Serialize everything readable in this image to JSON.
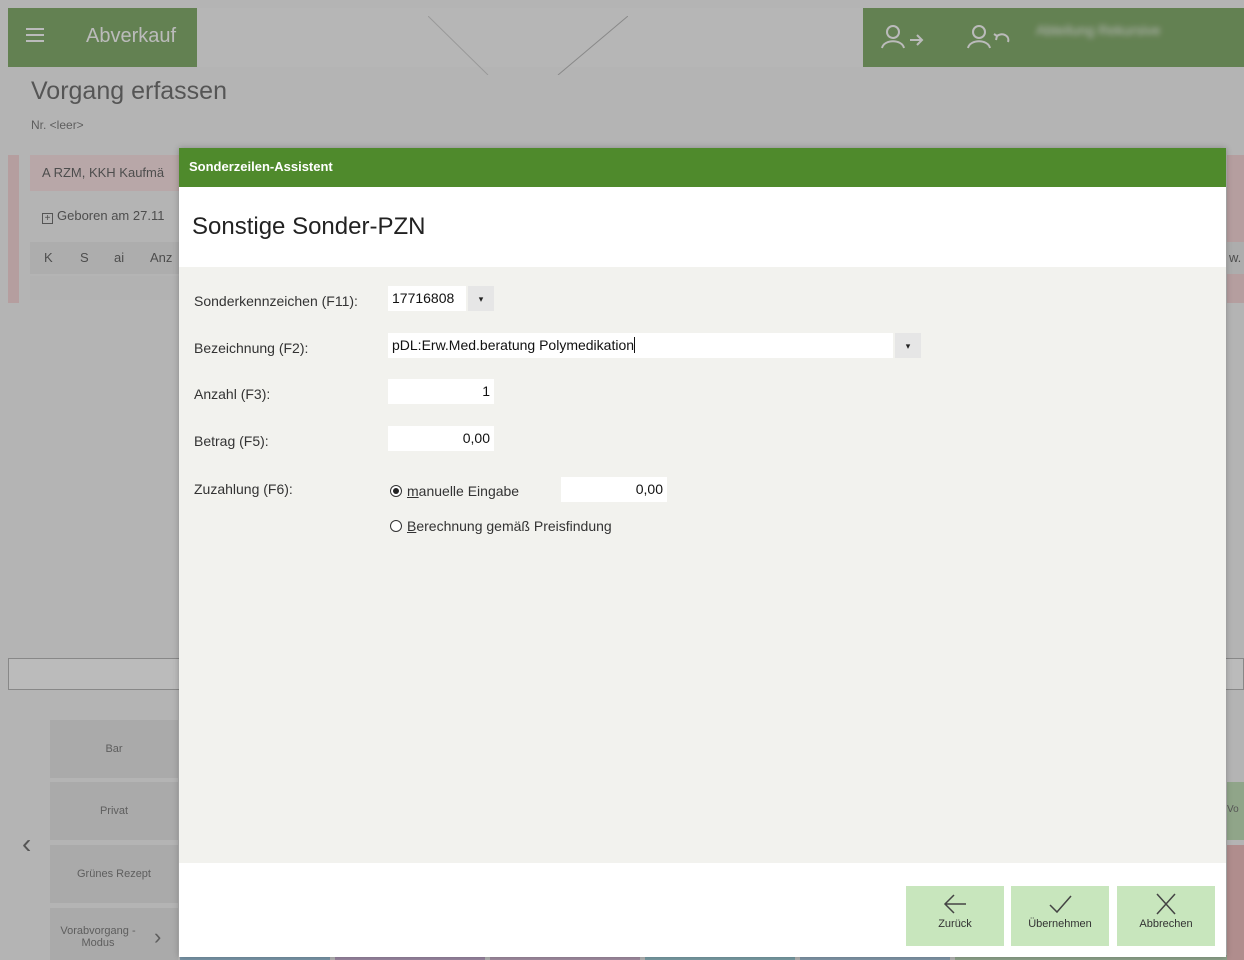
{
  "app": {
    "title": "Abverkauf",
    "user_name": "Abteilung Rekursive",
    "page_title": "Vorgang erfassen",
    "page_number": "Nr. <leer>",
    "patient_row": "A  RZM, KKH Kaufmä",
    "born_row": "Geboren am 27.11",
    "columns": [
      "K",
      "S",
      "ai",
      "Anz"
    ],
    "right_col_fragment": "w.",
    "side_buttons": [
      "Bar",
      "Privat",
      "Grünes Rezept",
      "Vorabvorgang - Modus"
    ],
    "right_green_fragment": "Vo",
    "colors": {
      "accent": "#4f8a2c",
      "button_green": "#c8e6bd"
    }
  },
  "dialog": {
    "titlebar": "Sonderzeilen-Assistent",
    "heading": "Sonstige Sonder-PZN",
    "fields": {
      "sonderkennzeichen": {
        "label": "Sonderkennzeichen (F11):",
        "value": "17716808"
      },
      "bezeichnung": {
        "label": "Bezeichnung (F2):",
        "value": "pDL:Erw.Med.beratung Polymedikation"
      },
      "anzahl": {
        "label": "Anzahl (F3):",
        "value": "1"
      },
      "betrag": {
        "label": "Betrag (F5):",
        "value": "0,00"
      },
      "zuzahlung": {
        "label": "Zuzahlung (F6):",
        "option_manual_key": "m",
        "option_manual_rest": "anuelle Eingabe",
        "option_manual_selected": true,
        "manual_value": "0,00",
        "option_calc_key": "B",
        "option_calc_rest": "erechnung gemäß Preisfindung"
      }
    },
    "footer": {
      "back_label": "Zurück",
      "apply_label": "Übernehmen",
      "cancel_label": "Abbrechen"
    }
  }
}
